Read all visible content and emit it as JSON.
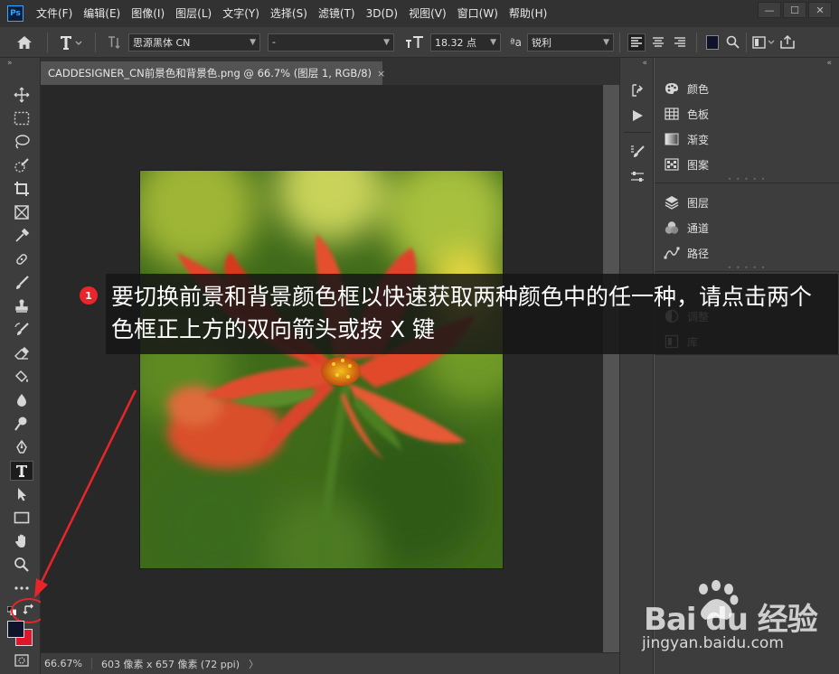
{
  "app": {
    "logo_text": "Ps"
  },
  "menu": [
    "文件(F)",
    "编辑(E)",
    "图像(I)",
    "图层(L)",
    "文字(Y)",
    "选择(S)",
    "滤镜(T)",
    "3D(D)",
    "视图(V)",
    "窗口(W)",
    "帮助(H)"
  ],
  "window_buttons": [
    "—",
    "☐",
    "✕"
  ],
  "options_bar": {
    "font_family": "思源黑体 CN",
    "font_style": "-",
    "font_size": "18.32 点",
    "aa_label": "ªa",
    "antialias": "锐利"
  },
  "document": {
    "tab_title": "CADDESIGNER_CN前景色和背景色.png @ 66.7% (图层 1, RGB/8)",
    "close_glyph": "×"
  },
  "status": {
    "zoom": "66.67%",
    "doc_info": "603 像素 x 657 像素 (72 ppi)",
    "arrow": "〉"
  },
  "panels": {
    "group1": [
      {
        "label": "颜色",
        "icon": "palette-icon"
      },
      {
        "label": "色板",
        "icon": "swatches-icon"
      },
      {
        "label": "渐变",
        "icon": "gradient-icon"
      },
      {
        "label": "图案",
        "icon": "pattern-icon"
      }
    ],
    "group2": [
      {
        "label": "图层",
        "icon": "layers-icon"
      },
      {
        "label": "通道",
        "icon": "channels-icon"
      },
      {
        "label": "路径",
        "icon": "paths-icon"
      }
    ],
    "group3": [
      {
        "label": "调整",
        "icon": "adjustments-icon"
      },
      {
        "label": "库",
        "icon": "libraries-icon"
      }
    ]
  },
  "colors": {
    "foreground": "#10142a",
    "background": "#e0142a",
    "accent_red": "#e8262a"
  },
  "annotation": {
    "badge": "1",
    "text": "要切换前景和背景颜色框以快速获取两种颜色中的任一种，请点击两个色框正上方的双向箭头或按 X 键"
  },
  "watermark": {
    "brand": "Bai du 经验",
    "url": "jingyan.baidu.com"
  }
}
